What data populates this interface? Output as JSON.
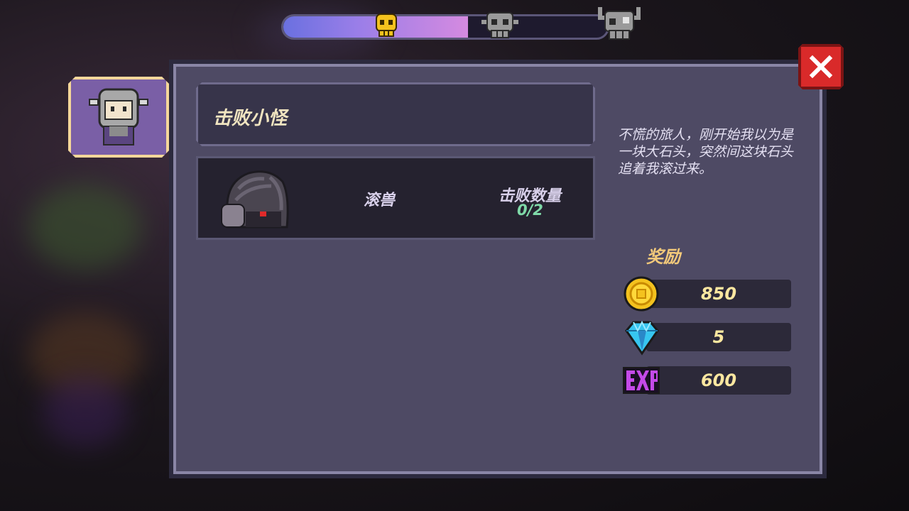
{
  "progress": {
    "fill": 0.57,
    "colors": {
      "track": "#1e1a2e",
      "fill_start": "#6a70e0",
      "fill_end": "#d58ae0"
    },
    "markers": [
      {
        "icon": "small-skull-icon",
        "state": "active",
        "color": "#f4c21e"
      },
      {
        "icon": "medium-skull-icon",
        "state": "locked",
        "color": "#9a9a9a"
      },
      {
        "icon": "horned-skull-icon",
        "state": "locked",
        "color": "#9a9a9a"
      }
    ]
  },
  "character": {
    "icon": "horned-helmet-knight-icon",
    "selected": true
  },
  "quest": {
    "title": "击败小怪",
    "target": {
      "monster_icon": "rolling-beast-icon",
      "monster_name": "滚兽",
      "count_label": "击败数量",
      "count_value": "0/2"
    },
    "description": "不慌的旅人，刚开始我以为是一块大石头，突然间这块石头追着我滚过来。"
  },
  "rewards": {
    "title": "奖励",
    "items": [
      {
        "icon": "gold-coin-icon",
        "value": "850"
      },
      {
        "icon": "blue-gem-icon",
        "value": "5"
      },
      {
        "icon": "exp-icon",
        "value": "600"
      }
    ]
  },
  "close": {
    "icon": "close-icon",
    "color": "#d92a2a"
  }
}
